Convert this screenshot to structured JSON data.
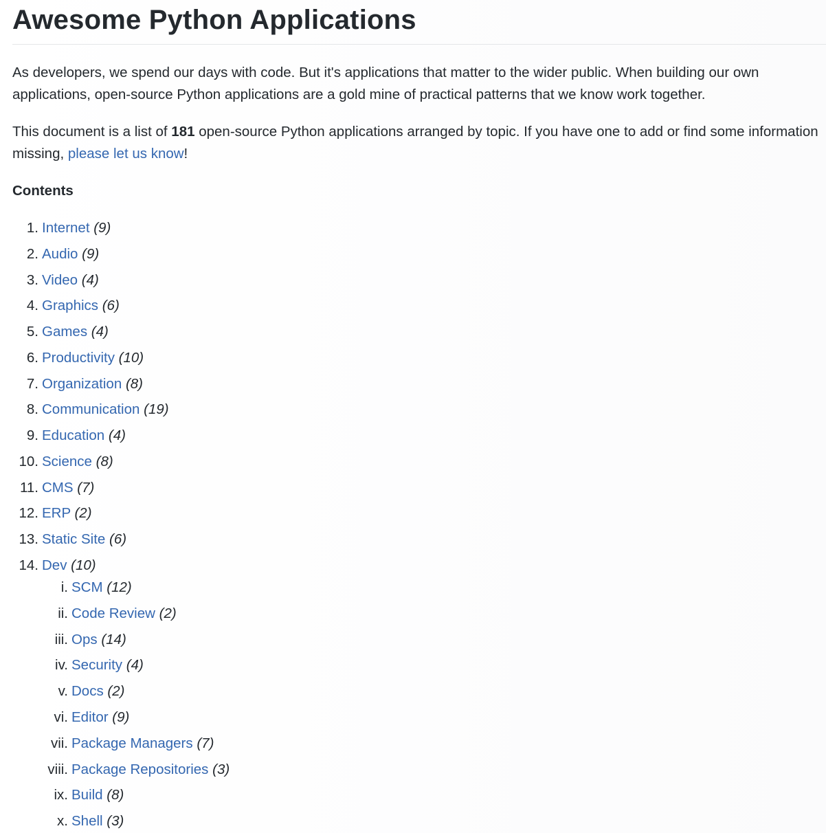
{
  "title": "Awesome Python Applications",
  "intro": "As developers, we spend our days with code. But it's applications that matter to the wider public. When building our own applications, open-source Python applications are a gold mine of practical patterns that we know work together.",
  "summary": {
    "before": "This document is a list of ",
    "count": "181",
    "after": " open-source Python applications arranged by topic. If you have one to add or find some information missing, ",
    "link_text": "please let us know",
    "end": "!"
  },
  "contents_heading": "Contents",
  "toc": [
    {
      "num": "1.",
      "label": "Internet",
      "count": "(9)"
    },
    {
      "num": "2.",
      "label": "Audio",
      "count": "(9)"
    },
    {
      "num": "3.",
      "label": "Video",
      "count": "(4)"
    },
    {
      "num": "4.",
      "label": "Graphics",
      "count": "(6)"
    },
    {
      "num": "5.",
      "label": "Games",
      "count": "(4)"
    },
    {
      "num": "6.",
      "label": "Productivity",
      "count": "(10)"
    },
    {
      "num": "7.",
      "label": "Organization",
      "count": "(8)"
    },
    {
      "num": "8.",
      "label": "Communication",
      "count": "(19)"
    },
    {
      "num": "9.",
      "label": "Education",
      "count": "(4)"
    },
    {
      "num": "10.",
      "label": "Science",
      "count": "(8)"
    },
    {
      "num": "11.",
      "label": "CMS",
      "count": "(7)"
    },
    {
      "num": "12.",
      "label": "ERP",
      "count": "(2)"
    },
    {
      "num": "13.",
      "label": "Static Site",
      "count": "(6)"
    },
    {
      "num": "14.",
      "label": "Dev",
      "count": "(10)"
    }
  ],
  "dev_sub": [
    {
      "num": "i.",
      "label": "SCM",
      "count": "(12)"
    },
    {
      "num": "ii.",
      "label": "Code Review",
      "count": "(2)"
    },
    {
      "num": "iii.",
      "label": "Ops",
      "count": "(14)"
    },
    {
      "num": "iv.",
      "label": "Security",
      "count": "(4)"
    },
    {
      "num": "v.",
      "label": "Docs",
      "count": "(2)"
    },
    {
      "num": "vi.",
      "label": "Editor",
      "count": "(9)"
    },
    {
      "num": "vii.",
      "label": "Package Managers",
      "count": "(7)"
    },
    {
      "num": "viii.",
      "label": "Package Repositories",
      "count": "(3)"
    },
    {
      "num": "ix.",
      "label": "Build",
      "count": "(8)"
    },
    {
      "num": "x.",
      "label": "Shell",
      "count": "(3)"
    }
  ],
  "colors": {
    "link": "#3467b0",
    "text": "#24292e",
    "rule": "#e4e6e8"
  }
}
